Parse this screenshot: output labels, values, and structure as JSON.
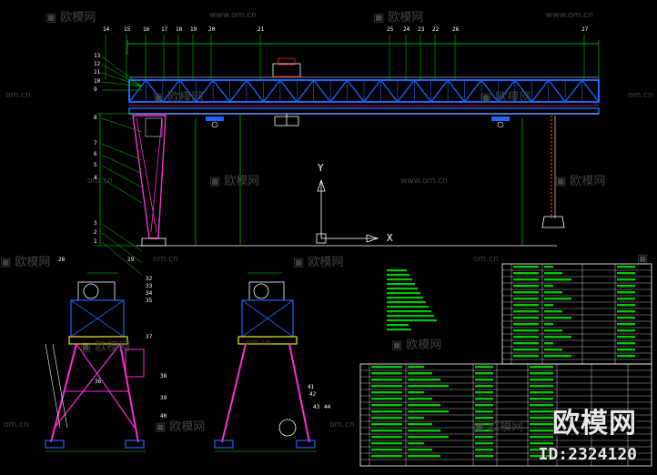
{
  "watermark": {
    "brand_cn": "欧模网",
    "site": "www.om.cn",
    "site_short": "om.cn"
  },
  "brand_overlay": {
    "name": "欧模网",
    "id": "ID:2324120"
  },
  "axis": {
    "y_label": "Y",
    "x_label": "X"
  },
  "callouts_top": [
    "14",
    "15",
    "16",
    "17",
    "18",
    "19",
    "20",
    "21",
    "25",
    "24",
    "23",
    "22",
    "26",
    "27"
  ],
  "callouts_left": [
    "13",
    "12",
    "11",
    "10",
    "9",
    "8",
    "7",
    "6",
    "5",
    "4",
    "3",
    "2",
    "1"
  ],
  "callouts_bottom_left": [
    "28",
    "29",
    "32",
    "33",
    "34",
    "35",
    "37",
    "38",
    "39",
    "40",
    "36"
  ],
  "callouts_bottom_mid": [
    "41",
    "42",
    "43",
    "44"
  ],
  "colors": {
    "background": "#000000",
    "truss": "#1e64ff",
    "leg_magenta": "#ff2bd6",
    "outline_white": "#ffffff",
    "dimension_green": "#00e000",
    "table_green": "#00c800",
    "highlight_yellow": "#f5e400",
    "red": "#ff2020",
    "cyan": "#00e5ff"
  }
}
